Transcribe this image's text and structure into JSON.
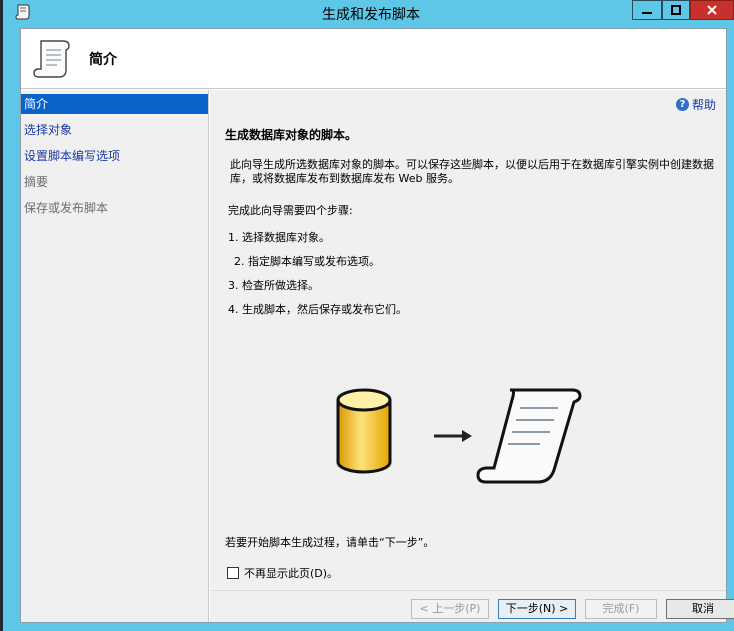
{
  "window": {
    "title": "生成和发布脚本"
  },
  "header": {
    "title": "简介"
  },
  "sidebar": {
    "items": [
      {
        "label": "简介",
        "state": "selected"
      },
      {
        "label": "选择对象",
        "state": "link"
      },
      {
        "label": "设置脚本编写选项",
        "state": "link"
      },
      {
        "label": "摘要",
        "state": "disabled"
      },
      {
        "label": "保存或发布脚本",
        "state": "disabled"
      }
    ]
  },
  "content": {
    "help_label": "帮助",
    "heading": "生成数据库对象的脚本。",
    "description": "此向导生成所选数据库对象的脚本。可以保存这些脚本，以便以后用于在数据库引擎实例中创建数据库，或将数据库发布到数据库发布 Web 服务。",
    "steps_intro": "完成此向导需要四个步骤:",
    "steps": [
      "1. 选择数据库对象。",
      "2. 指定脚本编写或发布选项。",
      "3. 检查所做选择。",
      "4. 生成脚本，然后保存或发布它们。"
    ],
    "start_note": "若要开始脚本生成过程，请单击“下一步”。",
    "dont_show_label": "不再显示此页(D)。"
  },
  "footer": {
    "prev_label": "< 上一步(P)",
    "next_label": "下一步(N) >",
    "finish_label": "完成(F)",
    "cancel_label": "取消"
  },
  "colors": {
    "selected_bg": "#0a64c8",
    "link": "#1a3aa0",
    "titlebar": "#5ec7e8",
    "close_button": "#c7302b"
  }
}
